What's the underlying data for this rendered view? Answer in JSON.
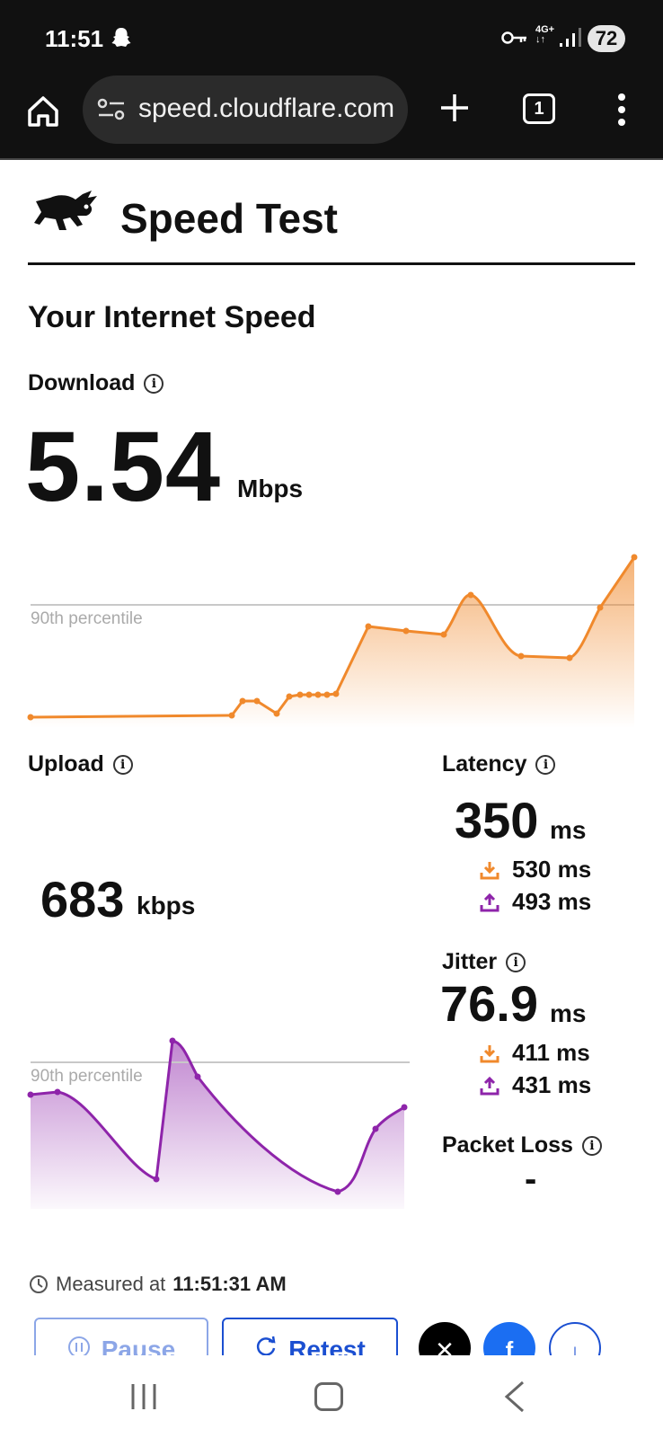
{
  "status_bar": {
    "time": "11:51",
    "network": "4G+",
    "battery": "72"
  },
  "browser": {
    "url": "speed.cloudflare.com",
    "tab_count": "1"
  },
  "page": {
    "brand_title": "Speed Test",
    "section_title": "Your Internet Speed",
    "download": {
      "label": "Download",
      "value": "5.54",
      "unit": "Mbps",
      "percentile_label": "90th percentile"
    },
    "upload": {
      "label": "Upload",
      "value": "683",
      "unit": "kbps",
      "percentile_label": "90th percentile"
    },
    "latency": {
      "label": "Latency",
      "value": "350",
      "unit": "ms",
      "down": "530 ms",
      "up": "493 ms"
    },
    "jitter": {
      "label": "Jitter",
      "value": "76.9",
      "unit": "ms",
      "down": "411 ms",
      "up": "431 ms"
    },
    "packet_loss": {
      "label": "Packet Loss",
      "value": "-"
    },
    "measured": {
      "prefix": "Measured at",
      "time": "11:51:31 AM"
    },
    "buttons": {
      "pause": "Pause",
      "retest": "Retest"
    }
  },
  "colors": {
    "download": "#f0892c",
    "upload": "#8e24aa",
    "accent": "#1b4fd1"
  },
  "icons": {
    "download_arrow": "download-icon",
    "upload_arrow": "upload-icon",
    "info": "info-icon",
    "clock": "clock-icon"
  }
}
